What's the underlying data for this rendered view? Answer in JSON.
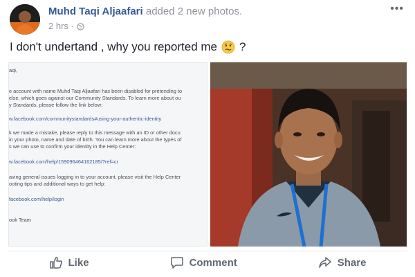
{
  "post": {
    "author_name": "Muhd Taqi Aljaafari",
    "action_text": "added 2 new photos.",
    "timestamp": "2 hrs",
    "separator": "·",
    "more_label": "•••",
    "text": "I don't undertand , why you reported me",
    "text_suffix": "?",
    "emoji": "confused-face-icon"
  },
  "photo_document": {
    "lines": [
      "aqi,",
      "",
      "e account with name Muhd Taqi Aljaafari has been disabled for pretending to",
      "else, which goes against our Community Standards. To learn more about ou",
      "y Standards, please follow the link below:",
      "",
      "w.facebook.com/communitystandards#using-your-authentic-identity",
      "",
      "k we made a mistake, please reply to this message with an ID or other docu",
      "in your photo, name and date of birth. You can learn more about the types of",
      "s we can use to confirm your identity in the Help Center:",
      "",
      "w.facebook.com/help/159096464162185/?ref=cr",
      "",
      "aving general issues logging in to your account, please visit the Help Center",
      "ooting tips and additional ways to get help:",
      "",
      "facebook.com/help/login",
      "",
      "ook Team"
    ]
  },
  "actions": {
    "like_label": "Like",
    "comment_label": "Comment",
    "share_label": "Share"
  },
  "colors": {
    "name_blue": "#365899",
    "meta_gray": "#90949c",
    "action_gray": "#606770",
    "link_blue": "#3b5998"
  }
}
